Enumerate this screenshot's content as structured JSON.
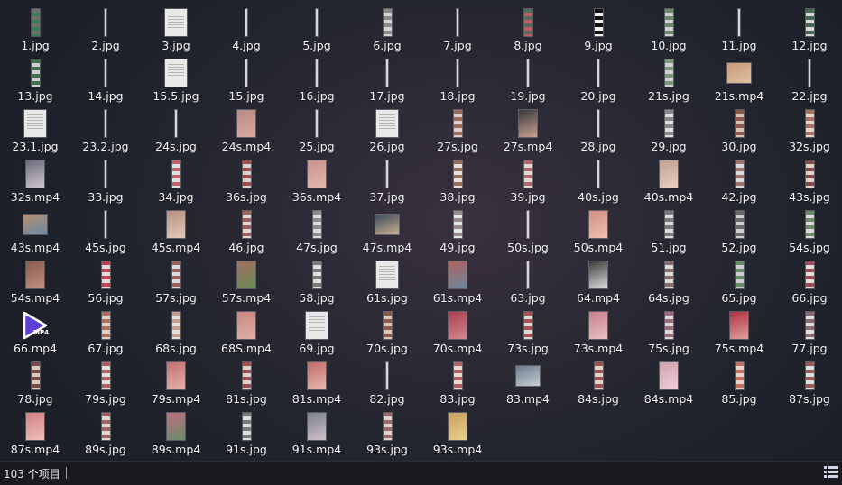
{
  "colors": {
    "background": "#22242c",
    "status_bar": "#191a1f",
    "text": "#f2f2f2",
    "mp4_icon": "#5b3fd6"
  },
  "files": [
    {
      "name": "1.jpg",
      "thumb": "strip",
      "c1": "#6f6f6f",
      "c2": "#3a7a5a"
    },
    {
      "name": "2.jpg",
      "thumb": "line"
    },
    {
      "name": "3.jpg",
      "thumb": "doc"
    },
    {
      "name": "4.jpg",
      "thumb": "line"
    },
    {
      "name": "5.jpg",
      "thumb": "line"
    },
    {
      "name": "6.jpg",
      "thumb": "strip",
      "c1": "#8a8a8a",
      "c2": "#d4d4d4"
    },
    {
      "name": "7.jpg",
      "thumb": "line"
    },
    {
      "name": "8.jpg",
      "thumb": "strip",
      "c1": "#4f6f5f",
      "c2": "#c45a5a"
    },
    {
      "name": "9.jpg",
      "thumb": "strip",
      "c1": "#111111",
      "c2": "#eeeeee"
    },
    {
      "name": "10.jpg",
      "thumb": "strip",
      "c1": "#6a8a6a",
      "c2": "#cfcfcf"
    },
    {
      "name": "11.jpg",
      "thumb": "line"
    },
    {
      "name": "12.jpg",
      "thumb": "strip",
      "c1": "#3f6f4f",
      "c2": "#d9d9d9"
    },
    {
      "name": "13.jpg",
      "thumb": "strip",
      "c1": "#3f6f4f",
      "c2": "#cfcfcf"
    },
    {
      "name": "14.jpg",
      "thumb": "line"
    },
    {
      "name": "15.5.jpg",
      "thumb": "doc"
    },
    {
      "name": "15.jpg",
      "thumb": "line"
    },
    {
      "name": "16.jpg",
      "thumb": "line"
    },
    {
      "name": "17.jpg",
      "thumb": "line"
    },
    {
      "name": "18.jpg",
      "thumb": "line"
    },
    {
      "name": "19.jpg",
      "thumb": "line"
    },
    {
      "name": "20.jpg",
      "thumb": "line"
    },
    {
      "name": "21s.jpg",
      "thumb": "strip",
      "c1": "#7a9a7a",
      "c2": "#d0d0d0"
    },
    {
      "name": "21s.mp4",
      "thumb": "wide",
      "c1": "#c89a78",
      "c2": "#e0c0a0"
    },
    {
      "name": "22.jpg",
      "thumb": "line"
    },
    {
      "name": "23.1.jpg",
      "thumb": "doc"
    },
    {
      "name": "23.2.jpg",
      "thumb": "line"
    },
    {
      "name": "24s.jpg",
      "thumb": "line"
    },
    {
      "name": "24s.mp4",
      "thumb": "photo",
      "c1": "#b88a84",
      "c2": "#d8aaa0"
    },
    {
      "name": "25.jpg",
      "thumb": "line"
    },
    {
      "name": "26.jpg",
      "thumb": "doc"
    },
    {
      "name": "27s.jpg",
      "thumb": "strip",
      "c1": "#a06a5a",
      "c2": "#e0d0c8"
    },
    {
      "name": "27s.mp4",
      "thumb": "photo",
      "c1": "#3a3a3a",
      "c2": "#c8a090"
    },
    {
      "name": "28.jpg",
      "thumb": "line"
    },
    {
      "name": "29.jpg",
      "thumb": "strip",
      "c1": "#8a8a8a",
      "c2": "#dddddd"
    },
    {
      "name": "30.jpg",
      "thumb": "strip",
      "c1": "#8a5a4a",
      "c2": "#dcc0b0"
    },
    {
      "name": "32s.jpg",
      "thumb": "strip",
      "c1": "#b07060",
      "c2": "#e8d0c0"
    },
    {
      "name": "32s.mp4",
      "thumb": "photo",
      "c1": "#6a6a7a",
      "c2": "#d0c8d0"
    },
    {
      "name": "33.jpg",
      "thumb": "line"
    },
    {
      "name": "34.jpg",
      "thumb": "strip",
      "c1": "#c06070",
      "c2": "#e0e0e0"
    },
    {
      "name": "36s.jpg",
      "thumb": "strip",
      "c1": "#a05050",
      "c2": "#e0d0d0"
    },
    {
      "name": "36s.mp4",
      "thumb": "photo",
      "c1": "#c89088",
      "c2": "#e0b8b0"
    },
    {
      "name": "37.jpg",
      "thumb": "line"
    },
    {
      "name": "38.jpg",
      "thumb": "strip",
      "c1": "#9a6a5a",
      "c2": "#e8e0d8"
    },
    {
      "name": "39.jpg",
      "thumb": "strip",
      "c1": "#b06a6a",
      "c2": "#e0d8d0"
    },
    {
      "name": "40s.jpg",
      "thumb": "line"
    },
    {
      "name": "40s.mp4",
      "thumb": "photo",
      "c1": "#c0a090",
      "c2": "#e8d0c0"
    },
    {
      "name": "42.jpg",
      "thumb": "strip",
      "c1": "#a07070",
      "c2": "#dcdcdc"
    },
    {
      "name": "43s.jpg",
      "thumb": "strip",
      "c1": "#8a4a4a",
      "c2": "#e0d0c8"
    },
    {
      "name": "43s.mp4",
      "thumb": "wide",
      "c1": "#b89070",
      "c2": "#6a88a8"
    },
    {
      "name": "45s.jpg",
      "thumb": "line"
    },
    {
      "name": "45s.mp4",
      "thumb": "photo",
      "c1": "#b89080",
      "c2": "#e0c8b8"
    },
    {
      "name": "46.jpg",
      "thumb": "strip",
      "c1": "#a06060",
      "c2": "#e0d8d0"
    },
    {
      "name": "47s.jpg",
      "thumb": "strip",
      "c1": "#8a8a8a",
      "c2": "#d8d8d8"
    },
    {
      "name": "47s.mp4",
      "thumb": "wide",
      "c1": "#3a4a5a",
      "c2": "#c8b090"
    },
    {
      "name": "49.jpg",
      "thumb": "strip",
      "c1": "#9a8a8a",
      "c2": "#e8e8e8"
    },
    {
      "name": "50s.jpg",
      "thumb": "line"
    },
    {
      "name": "50s.mp4",
      "thumb": "photo",
      "c1": "#d09080",
      "c2": "#f0c0b0"
    },
    {
      "name": "51.jpg",
      "thumb": "strip",
      "c1": "#7a7a7a",
      "c2": "#dddddd"
    },
    {
      "name": "52.jpg",
      "thumb": "strip",
      "c1": "#6a6a6a",
      "c2": "#d0d0d0"
    },
    {
      "name": "54s.jpg",
      "thumb": "strip",
      "c1": "#6a8a6a",
      "c2": "#d8d8d8"
    },
    {
      "name": "54s.mp4",
      "thumb": "photo",
      "c1": "#8a5a4a",
      "c2": "#c09080"
    },
    {
      "name": "56.jpg",
      "thumb": "strip",
      "c1": "#c04050",
      "c2": "#e8d8d8"
    },
    {
      "name": "57s.jpg",
      "thumb": "strip",
      "c1": "#9a6060",
      "c2": "#dddddd"
    },
    {
      "name": "57s.mp4",
      "thumb": "photo",
      "c1": "#a07060",
      "c2": "#6a8a5a"
    },
    {
      "name": "58.jpg",
      "thumb": "strip",
      "c1": "#7a7a7a",
      "c2": "#dcdcdc"
    },
    {
      "name": "61s.jpg",
      "thumb": "doc"
    },
    {
      "name": "61s.mp4",
      "thumb": "photo",
      "c1": "#b06060",
      "c2": "#6a8a9a"
    },
    {
      "name": "63.jpg",
      "thumb": "line"
    },
    {
      "name": "64.mp4",
      "thumb": "photo",
      "c1": "#3a3a3a",
      "c2": "#dddddd"
    },
    {
      "name": "64s.jpg",
      "thumb": "strip",
      "c1": "#8a6a6a",
      "c2": "#dddddd"
    },
    {
      "name": "65.jpg",
      "thumb": "strip",
      "c1": "#6a8a6a",
      "c2": "#d0d0d0"
    },
    {
      "name": "66.jpg",
      "thumb": "strip",
      "c1": "#a04a5a",
      "c2": "#e8d8d8"
    },
    {
      "name": "66.mp4",
      "thumb": "mp4"
    },
    {
      "name": "67.jpg",
      "thumb": "strip",
      "c1": "#b07060",
      "c2": "#e0d0c0"
    },
    {
      "name": "68s.jpg",
      "thumb": "strip",
      "c1": "#c0a090",
      "c2": "#e8e0d8"
    },
    {
      "name": "68S.mp4",
      "thumb": "photo",
      "c1": "#c88880",
      "c2": "#e0b0a8"
    },
    {
      "name": "69.jpg",
      "thumb": "doc"
    },
    {
      "name": "70s.jpg",
      "thumb": "strip",
      "c1": "#8a5a4a",
      "c2": "#d8c8b8"
    },
    {
      "name": "70s.mp4",
      "thumb": "photo",
      "c1": "#a84050",
      "c2": "#d08890"
    },
    {
      "name": "73s.jpg",
      "thumb": "strip",
      "c1": "#b05050",
      "c2": "#e0d8d0"
    },
    {
      "name": "73s.mp4",
      "thumb": "photo",
      "c1": "#c88090",
      "c2": "#e8c0c0"
    },
    {
      "name": "75s.jpg",
      "thumb": "strip",
      "c1": "#a06a7a",
      "c2": "#e0d8d8"
    },
    {
      "name": "75s.mp4",
      "thumb": "photo",
      "c1": "#b03040",
      "c2": "#e0a0a0"
    },
    {
      "name": "77.jpg",
      "thumb": "strip",
      "c1": "#8a6a6a",
      "c2": "#dddddd"
    },
    {
      "name": "78.jpg",
      "thumb": "strip",
      "c1": "#7a4a4a",
      "c2": "#d8c8c0"
    },
    {
      "name": "79s.jpg",
      "thumb": "strip",
      "c1": "#b06060",
      "c2": "#e8e0d8"
    },
    {
      "name": "79s.mp4",
      "thumb": "photo",
      "c1": "#c07070",
      "c2": "#e8b0a8"
    },
    {
      "name": "81s.jpg",
      "thumb": "strip",
      "c1": "#a05050",
      "c2": "#e0d0c8"
    },
    {
      "name": "81s.mp4",
      "thumb": "photo",
      "c1": "#c06a6a",
      "c2": "#e8b8b0"
    },
    {
      "name": "82.jpg",
      "thumb": "line"
    },
    {
      "name": "83.jpg",
      "thumb": "strip",
      "c1": "#b06060",
      "c2": "#e8d8d0"
    },
    {
      "name": "83.mp4",
      "thumb": "wide",
      "c1": "#6a7a8a",
      "c2": "#c8d0d8"
    },
    {
      "name": "84s.jpg",
      "thumb": "strip",
      "c1": "#a05050",
      "c2": "#e0d0c8"
    },
    {
      "name": "84s.mp4",
      "thumb": "photo",
      "c1": "#d0a0b0",
      "c2": "#f0d0d8"
    },
    {
      "name": "85.jpg",
      "thumb": "strip",
      "c1": "#c07060",
      "c2": "#e8d8c8"
    },
    {
      "name": "87s.jpg",
      "thumb": "strip",
      "c1": "#9a5a5a",
      "c2": "#dddddd"
    },
    {
      "name": "87s.mp4",
      "thumb": "photo",
      "c1": "#d08080",
      "c2": "#f0c0b8"
    },
    {
      "name": "89s.jpg",
      "thumb": "strip",
      "c1": "#a06060",
      "c2": "#e0d8d0"
    },
    {
      "name": "89s.mp4",
      "thumb": "photo",
      "c1": "#c07080",
      "c2": "#6a8a6a"
    },
    {
      "name": "91s.jpg",
      "thumb": "strip",
      "c1": "#7a7a7a",
      "c2": "#dddddd"
    },
    {
      "name": "91s.mp4",
      "thumb": "photo",
      "c1": "#7a8090",
      "c2": "#d0c0c8"
    },
    {
      "name": "93s.jpg",
      "thumb": "strip",
      "c1": "#a06a6a",
      "c2": "#e0d8d0"
    },
    {
      "name": "93s.mp4",
      "thumb": "photo",
      "c1": "#c8a060",
      "c2": "#e8d090"
    }
  ],
  "status": {
    "count": "103 个项目"
  },
  "icons": {
    "view_toggle": "details-view-icon",
    "mp4": "video-play-icon"
  }
}
